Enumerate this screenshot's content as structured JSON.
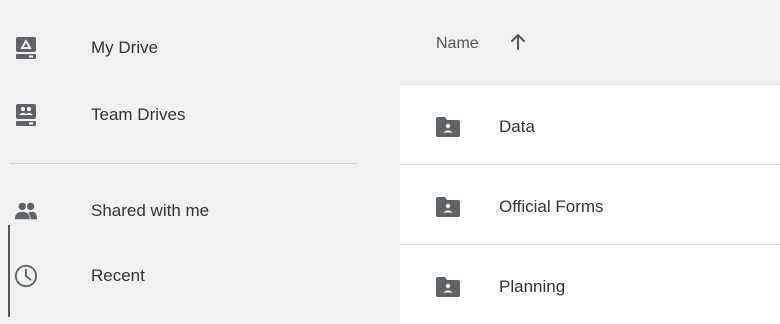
{
  "sidebar": {
    "items": [
      {
        "label": "My Drive",
        "icon": "drive-icon"
      },
      {
        "label": "Team Drives",
        "icon": "team-drives-icon"
      },
      {
        "label": "Shared with me",
        "icon": "people-icon"
      },
      {
        "label": "Recent",
        "icon": "clock-icon"
      }
    ]
  },
  "file_list": {
    "header": {
      "name_label": "Name",
      "sort": "ascending"
    },
    "rows": [
      {
        "name": "Data",
        "icon": "shared-folder-icon"
      },
      {
        "name": "Official Forms",
        "icon": "shared-folder-icon"
      },
      {
        "name": "Planning",
        "icon": "shared-folder-icon"
      }
    ]
  },
  "colors": {
    "background": "#f1f1f1",
    "row_background": "#ffffff",
    "icon": "#5f6368",
    "text": "#333333"
  }
}
